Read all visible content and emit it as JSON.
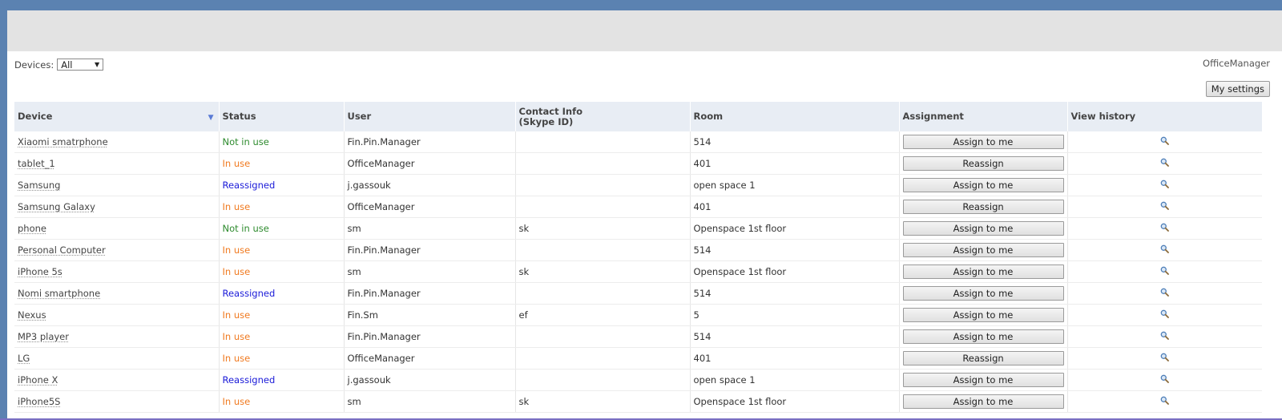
{
  "filter": {
    "label": "Devices:",
    "selected": "All"
  },
  "user": {
    "name": "OfficeManager"
  },
  "settings_button": "My settings",
  "columns": {
    "device": "Device",
    "status": "Status",
    "user": "User",
    "contact_line1": "Contact Info",
    "contact_line2": "(Skype ID)",
    "room": "Room",
    "assignment": "Assignment",
    "history": "View history"
  },
  "rows": [
    {
      "device": "Xiaomi smatrphone",
      "status": "Not in use",
      "status_type": "notinuse",
      "user": "Fin.Pin.Manager",
      "contact": "",
      "room": "514",
      "action": "Assign to me"
    },
    {
      "device": "tablet_1",
      "status": "In use",
      "status_type": "inuse",
      "user": "OfficeManager",
      "contact": "",
      "room": "401",
      "action": "Reassign"
    },
    {
      "device": "Samsung",
      "status": "Reassigned",
      "status_type": "reassigned",
      "user": "j.gassouk",
      "contact": "",
      "room": "open space 1",
      "action": "Assign to me"
    },
    {
      "device": "Samsung Galaxy",
      "status": "In use",
      "status_type": "inuse",
      "user": "OfficeManager",
      "contact": "",
      "room": "401",
      "action": "Reassign"
    },
    {
      "device": "phone",
      "status": "Not in use",
      "status_type": "notinuse",
      "user": "sm",
      "contact": "sk",
      "room": "Openspace 1st floor",
      "action": "Assign to me"
    },
    {
      "device": "Personal Computer",
      "status": "In use",
      "status_type": "inuse",
      "user": "Fin.Pin.Manager",
      "contact": "",
      "room": "514",
      "action": "Assign to me"
    },
    {
      "device": "iPhone 5s",
      "status": "In use",
      "status_type": "inuse",
      "user": "sm",
      "contact": "sk",
      "room": "Openspace 1st floor",
      "action": "Assign to me"
    },
    {
      "device": "Nomi smartphone",
      "status": "Reassigned",
      "status_type": "reassigned",
      "user": "Fin.Pin.Manager",
      "contact": "",
      "room": "514",
      "action": "Assign to me"
    },
    {
      "device": "Nexus",
      "status": "In use",
      "status_type": "inuse",
      "user": "Fin.Sm",
      "contact": "ef",
      "room": "5",
      "action": "Assign to me"
    },
    {
      "device": "MP3 player",
      "status": "In use",
      "status_type": "inuse",
      "user": "Fin.Pin.Manager",
      "contact": "",
      "room": "514",
      "action": "Assign to me"
    },
    {
      "device": "LG",
      "status": "In use",
      "status_type": "inuse",
      "user": "OfficeManager",
      "contact": "",
      "room": "401",
      "action": "Reassign"
    },
    {
      "device": "iPhone X",
      "status": "Reassigned",
      "status_type": "reassigned",
      "user": "j.gassouk",
      "contact": "",
      "room": "open space 1",
      "action": "Assign to me"
    },
    {
      "device": "iPhone5S",
      "status": "In use",
      "status_type": "inuse",
      "user": "sm",
      "contact": "sk",
      "room": "Openspace 1st floor",
      "action": "Assign to me"
    }
  ],
  "colors": {
    "frame_bg": "#5b82b1",
    "header_bg": "#e8edf4",
    "status_notinuse": "#2e8b2e",
    "status_inuse": "#f07a20",
    "status_reassigned": "#1a1ad8"
  },
  "icons": {
    "sort": "sort-desc-icon",
    "history": "magnifier-icon",
    "dropdown": "dropdown-arrow-icon"
  }
}
